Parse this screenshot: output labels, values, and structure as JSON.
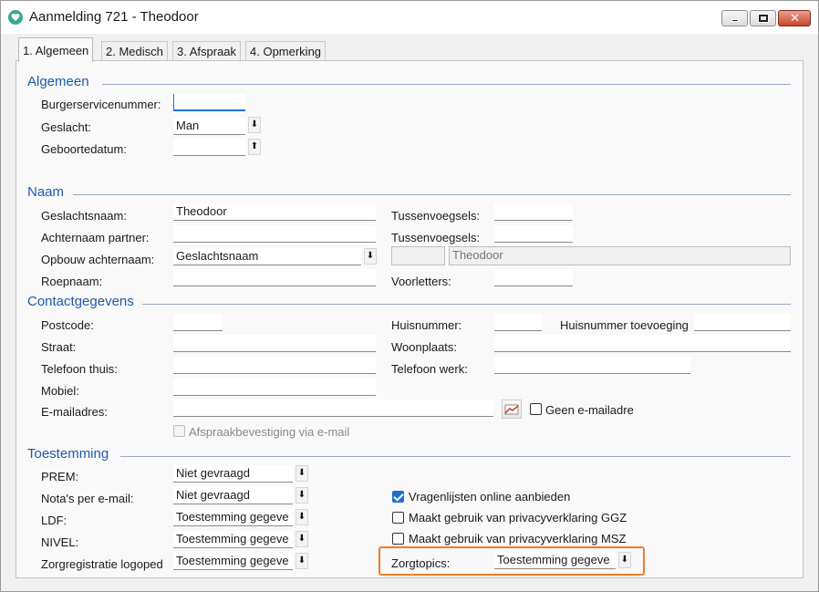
{
  "window": {
    "title": "Aanmelding 721 - Theodoor",
    "app_icon": "heart-chat-icon",
    "controls": {
      "minimize": "minimize-icon",
      "maximize": "maximize-icon",
      "close": "✕"
    }
  },
  "tabs": [
    {
      "label": "1. Algemeen",
      "active": true
    },
    {
      "label": "2. Medisch",
      "active": false
    },
    {
      "label": "3. Afspraak",
      "active": false
    },
    {
      "label": "4. Opmerking",
      "active": false
    }
  ],
  "sections": {
    "algemeen": "Algemeen",
    "naam": "Naam",
    "contact": "Contactgegevens",
    "toestemming": "Toestemming"
  },
  "algemeen": {
    "bsn_label": "Burgerservicenummer:",
    "bsn_value": "",
    "geslacht_label": "Geslacht:",
    "geslacht_value": "Man",
    "geboortedatum_label": "Geboortedatum:",
    "geboortedatum_value": ""
  },
  "naam": {
    "geslachtsnaam_label": "Geslachtsnaam:",
    "geslachtsnaam_value": "Theodoor",
    "tussenvoegsels_label": "Tussenvoegsels:",
    "tussenvoegsels_value": "",
    "achternaam_partner_label": "Achternaam partner:",
    "achternaam_partner_value": "",
    "tussenvoegsels2_label": "Tussenvoegsels:",
    "tussenvoegsels2_value": "",
    "opbouw_label": "Opbouw achternaam:",
    "opbouw_value": "Geslachtsnaam",
    "opbouw_preview_prefix": "",
    "opbouw_preview": "Theodoor",
    "roepnaam_label": "Roepnaam:",
    "roepnaam_value": "",
    "voorletters_label": "Voorletters:",
    "voorletters_value": ""
  },
  "contact": {
    "postcode_label": "Postcode:",
    "huisnummer_label": "Huisnummer:",
    "huisnummer_toevoeging_label": "Huisnummer toevoeging",
    "straat_label": "Straat:",
    "woonplaats_label": "Woonplaats:",
    "telefoon_thuis_label": "Telefoon thuis:",
    "telefoon_werk_label": "Telefoon werk:",
    "mobiel_label": "Mobiel:",
    "email_label": "E-mailadres:",
    "email_button_icon": "mail-edit-icon",
    "geen_email_label": "Geen e-mailadre",
    "afspraakbevestiging_label": "Afspraakbevestiging via e-mail"
  },
  "toestemming": {
    "prem_label": "PREM:",
    "prem_value": "Niet gevraagd",
    "notas_label": "Nota's per e-mail:",
    "notas_value": "Niet gevraagd",
    "ldf_label": "LDF:",
    "ldf_value": "Toestemming gegeve",
    "nivel_label": "NIVEL:",
    "nivel_value": "Toestemming gegeve",
    "zorgreg_label": "Zorgregistratie logoped",
    "zorgreg_value": "Toestemming gegeve",
    "vragenlijsten_label": "Vragenlijsten online aanbieden",
    "vragenlijsten_checked": true,
    "ggz_label": "Maakt gebruik van privacyverklaring GGZ",
    "ggz_checked": false,
    "msz_label": "Maakt gebruik van privacyverklaring MSZ",
    "msz_checked": false,
    "zorgtopics_label": "Zorgtopics:",
    "zorgtopics_value": "Toestemming gegeve"
  },
  "colors": {
    "section_title": "#1e5aa8",
    "highlight": "#f07c28",
    "checkbox_checked": "#1e6fd0"
  },
  "icons": {
    "dropdown": "⬇",
    "dropup": "⬆"
  }
}
